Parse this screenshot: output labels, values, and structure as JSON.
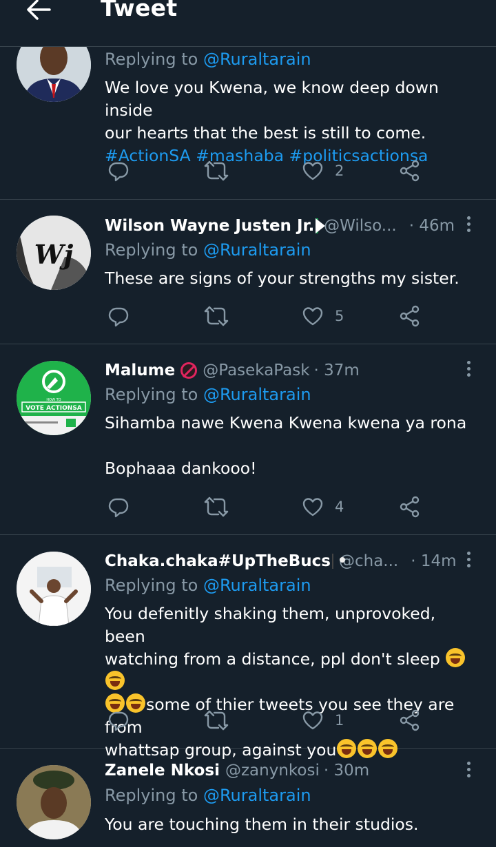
{
  "header": {
    "title": "Tweet"
  },
  "colors": {
    "background": "#15202b",
    "accent": "#1d9bf0",
    "muted": "#8899a6",
    "divider": "#38444d"
  },
  "tweets": [
    {
      "name": "",
      "handle": "",
      "time": "",
      "replying_prefix": "Replying to",
      "replying_to": "@Ruraltarain",
      "text_lines": [
        "We love you Kwena, we know deep down inside",
        "our hearts that the best is still to come."
      ],
      "hashtags": [
        "#ActionSA",
        "#mashaba",
        "#politicsactionsa"
      ],
      "likes": "2"
    },
    {
      "name": "Wilson Wayne Justen Jr.",
      "handle": "@Wilso...",
      "time": "· 46m",
      "replying_prefix": "Replying to",
      "replying_to": "@Ruraltarain",
      "text": "These are signs of your strengths my sister.",
      "likes": "5"
    },
    {
      "name": "Malume",
      "handle": "@PasekaPask",
      "time": "· 37m",
      "replying_prefix": "Replying to",
      "replying_to": "@Ruraltarain",
      "text_line1": "Sihamba nawe Kwena Kwena kwena ya rona",
      "text_line2": "Bophaaa dankooo!",
      "likes": "4",
      "avatar_text": "VOTE ACTIONSA",
      "avatar_small_text": "HOW TO"
    },
    {
      "name": "Chaka.chaka#UpTheBucs",
      "handle": "@cha...",
      "time": "· 14m",
      "replying_prefix": "Replying to",
      "replying_to": "@Ruraltarain",
      "text_line1": "You defenitly shaking them, unprovoked, been",
      "text_line2": "watching from a distance, ppl don't sleep",
      "text_line3": "some of thier tweets you see they are from",
      "text_line4": "whattsap group, against you",
      "likes": "1"
    },
    {
      "name": "Zanele Nkosi",
      "handle": "@zanynkosi",
      "time": "· 30m",
      "replying_prefix": "Replying to",
      "replying_to": "@Ruraltarain",
      "text": "You are touching them in their studios."
    }
  ]
}
